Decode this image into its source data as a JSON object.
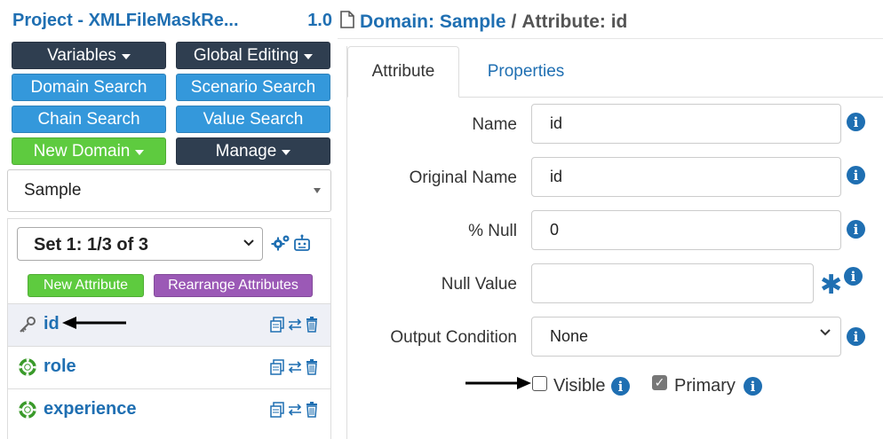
{
  "project": {
    "title": "Project - XMLFileMaskRe...",
    "version": "1.0"
  },
  "buttons": {
    "variables": "Variables",
    "global_editing": "Global Editing",
    "domain_search": "Domain Search",
    "scenario_search": "Scenario Search",
    "chain_search": "Chain Search",
    "value_search": "Value Search",
    "new_domain": "New Domain",
    "manage": "Manage"
  },
  "domain_select": {
    "value": "Sample"
  },
  "set_select": {
    "value": "Set 1: 1/3 of 3"
  },
  "attr_buttons": {
    "new_attribute": "New Attribute",
    "rearrange": "Rearrange Attributes"
  },
  "attributes": [
    {
      "label": "id",
      "icon": "key-icon",
      "selected": true
    },
    {
      "label": "role",
      "icon": "lifebuoy-icon"
    },
    {
      "label": "experience",
      "icon": "lifebuoy-icon"
    }
  ],
  "header": {
    "domain": "Domain: Sample",
    "separator": "/",
    "attribute": "Attribute: id"
  },
  "tabs": {
    "attribute": "Attribute",
    "properties": "Properties"
  },
  "form": {
    "name": {
      "label": "Name",
      "value": "id"
    },
    "original_name": {
      "label": "Original Name",
      "value": "id"
    },
    "pct_null": {
      "label": "% Null",
      "value": "0"
    },
    "null_value": {
      "label": "Null Value",
      "value": ""
    },
    "output_condition": {
      "label": "Output Condition",
      "value": "None"
    },
    "visible": {
      "label": "Visible",
      "checked": false
    },
    "primary": {
      "label": "Primary",
      "checked": true
    }
  },
  "colors": {
    "link_blue": "#1f6fb2",
    "dark_btn": "#2f3e50",
    "blue_btn": "#3498db",
    "green_btn": "#5ecb3f",
    "purple_btn": "#9b59b6"
  }
}
